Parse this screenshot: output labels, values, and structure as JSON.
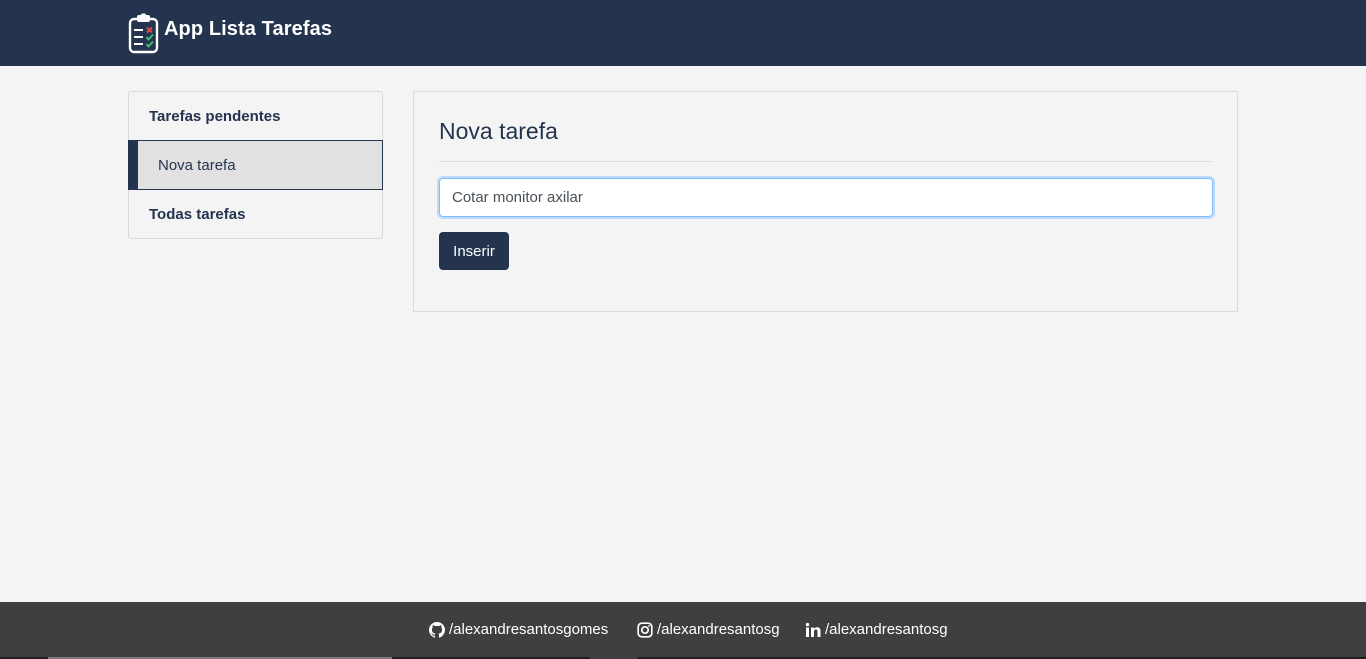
{
  "header": {
    "title": "App Lista Tarefas",
    "logo_icon": "clipboard-checklist-icon",
    "background": "#24344f"
  },
  "sidebar": {
    "items": [
      {
        "label": "Tarefas pendentes",
        "active": false
      },
      {
        "label": "Nova tarefa",
        "active": true
      },
      {
        "label": "Todas tarefas",
        "active": false
      }
    ]
  },
  "main": {
    "title": "Nova tarefa",
    "task_input": {
      "value": "Cotar monitor axilar"
    },
    "submit_label": "Inserir"
  },
  "footer": {
    "links": [
      {
        "icon": "github-icon",
        "label": "/alexandresantosgomes"
      },
      {
        "icon": "instagram-icon",
        "label": "/alexandresantosg"
      },
      {
        "icon": "linkedin-icon",
        "label": "/alexandresantosg"
      }
    ],
    "background": "#3f3f3f"
  },
  "colors": {
    "primary": "#24344f",
    "page_background": "#f4f4f4",
    "active_item": "#e1e1e1",
    "focus_ring": "#80bdff"
  }
}
